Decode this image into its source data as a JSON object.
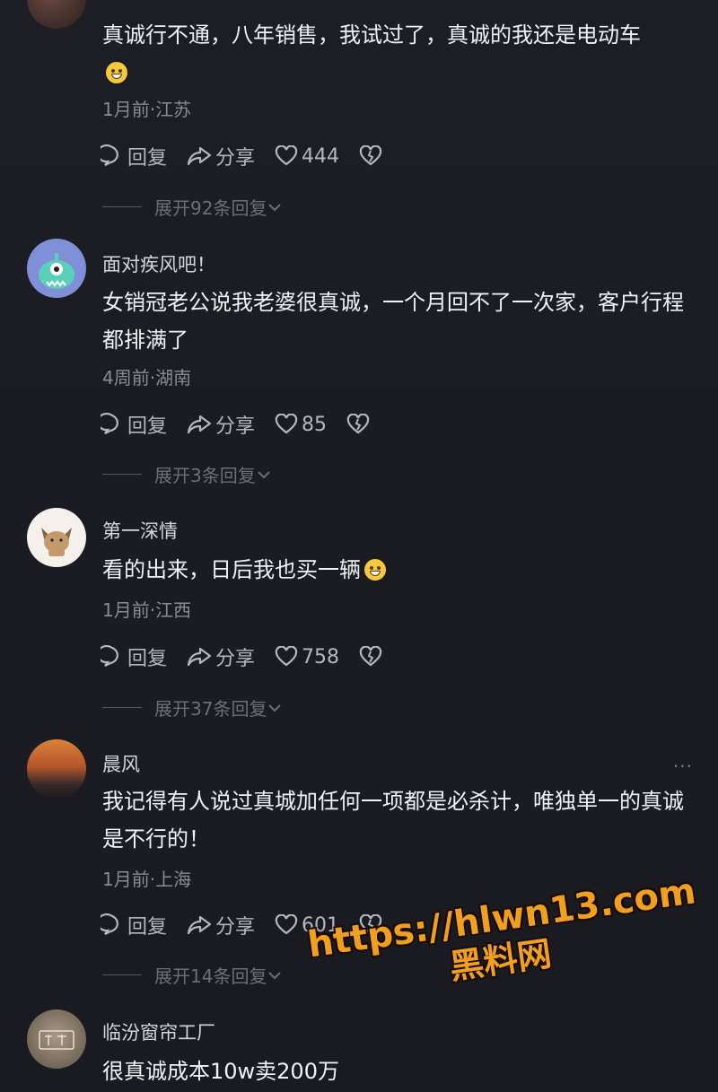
{
  "comments": [
    {
      "username": "",
      "text": "真诚行不通，八年销售，我试过了，真诚的我还是电动车",
      "meta": "1月前·江苏",
      "reply": "回复",
      "share": "分享",
      "likes": "444",
      "expand": "展开92条回复"
    },
    {
      "username": "面对疾风吧！",
      "text": "女销冠老公说我老婆很真诚，一个月回不了一次家，客户行程都排满了",
      "meta": "4周前·湖南",
      "reply": "回复",
      "share": "分享",
      "likes": "85",
      "expand": "展开3条回复"
    },
    {
      "username": "第一深情",
      "text": "看的出来，日后我也买一辆",
      "meta": "1月前·江西",
      "reply": "回复",
      "share": "分享",
      "likes": "758",
      "expand": "展开37条回复"
    },
    {
      "username": "晨风",
      "text": "我记得有人说过真城加任何一项都是必杀计，唯独单一的真诚是不行的！",
      "meta": "1月前·上海",
      "reply": "回复",
      "share": "分享",
      "likes": "601",
      "expand": "展开14条回复",
      "more": "···"
    },
    {
      "username": "临汾窗帘工厂",
      "text": "很真诚成本10w卖200万"
    }
  ],
  "watermark": {
    "url": "https://hlwn13.com",
    "name": "黑料网",
    "color": "#f0a01e"
  }
}
